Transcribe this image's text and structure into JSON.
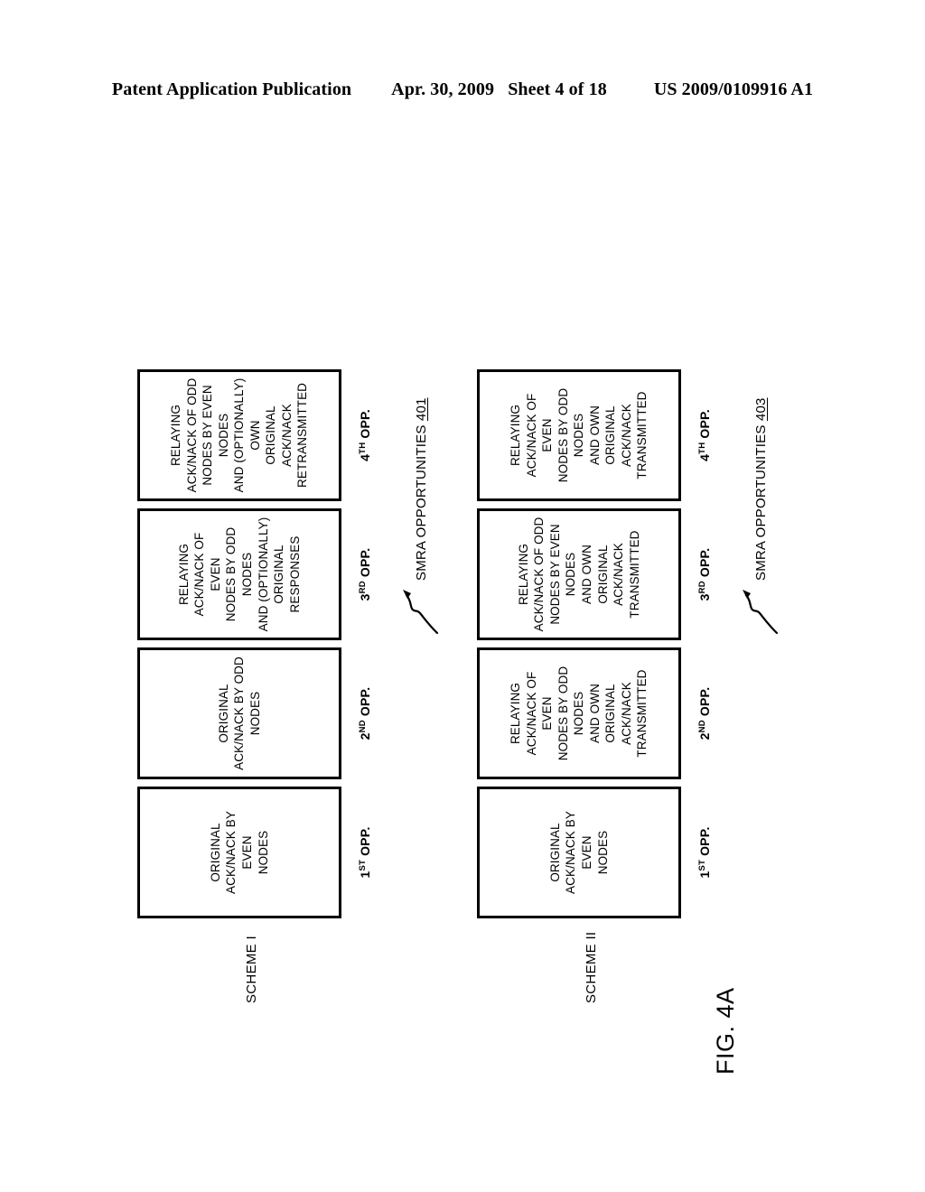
{
  "header": {
    "publication": "Patent Application Publication",
    "date": "Apr. 30, 2009",
    "sheet": "Sheet 4 of 18",
    "patent_number": "US 2009/0109916 A1"
  },
  "figure": {
    "label": "FIG. 4A",
    "schemes": [
      {
        "title": "SCHEME I",
        "annotation_text": "SMRA OPPORTUNITIES",
        "annotation_ref": "401",
        "arrow_icon": "curved-leader-arrow-icon",
        "steps": [
          {
            "opp_number": "1",
            "opp_suffix": "ST",
            "opp_label_tail": " OPP.",
            "box_text": "ORIGINAL\nACK/NACK BY EVEN\nNODES"
          },
          {
            "opp_number": "2",
            "opp_suffix": "ND",
            "opp_label_tail": " OPP.",
            "box_text": "ORIGINAL\nACK/NACK BY ODD\nNODES"
          },
          {
            "opp_number": "3",
            "opp_suffix": "RD",
            "opp_label_tail": " OPP.",
            "box_text": "RELAYING\nACK/NACK OF EVEN\nNODES BY ODD NODES\nAND (OPTIONALLY)\nORIGINAL RESPONSES"
          },
          {
            "opp_number": "4",
            "opp_suffix": "TH",
            "opp_label_tail": " OPP.",
            "box_text": "RELAYING\nACK/NACK OF ODD\nNODES BY EVEN NODES\nAND (OPTIONALLY) OWN\nORIGINAL ACK/NACK\nRETRANSMITTED"
          }
        ]
      },
      {
        "title": "SCHEME II",
        "annotation_text": "SMRA OPPORTUNITIES",
        "annotation_ref": "403",
        "arrow_icon": "curved-leader-arrow-icon",
        "steps": [
          {
            "opp_number": "1",
            "opp_suffix": "ST",
            "opp_label_tail": " OPP.",
            "box_text": "ORIGINAL\nACK/NACK BY EVEN\nNODES"
          },
          {
            "opp_number": "2",
            "opp_suffix": "ND",
            "opp_label_tail": " OPP.",
            "box_text": "RELAYING\nACK/NACK OF EVEN\nNODES BY ODD NODES\nAND OWN ORIGINAL\nACK/NACK TRANSMITTED"
          },
          {
            "opp_number": "3",
            "opp_suffix": "RD",
            "opp_label_tail": " OPP.",
            "box_text": "RELAYING\nACK/NACK OF ODD\nNODES BY EVEN NODES\nAND OWN ORIGINAL\nACK/NACK TRANSMITTED"
          },
          {
            "opp_number": "4",
            "opp_suffix": "TH",
            "opp_label_tail": " OPP.",
            "box_text": "RELAYING\nACK/NACK OF EVEN\nNODES BY ODD NODES\nAND OWN ORIGINAL\nACK/NACK TRANSMITTED"
          }
        ]
      }
    ]
  }
}
